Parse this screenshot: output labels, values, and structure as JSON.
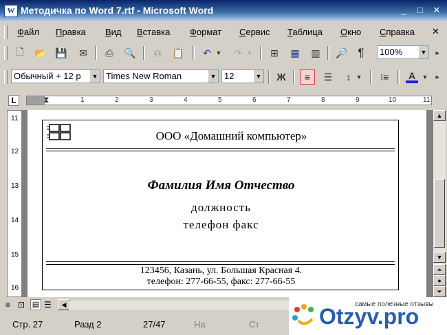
{
  "window": {
    "title": "Методичка по Word 7.rtf - Microsoft Word",
    "app_icon": "W",
    "controls": {
      "minimize": "_",
      "maximize": "□",
      "close": "✕"
    }
  },
  "menu": {
    "items": [
      "Файл",
      "Правка",
      "Вид",
      "Вставка",
      "Формат",
      "Сервис",
      "Таблица",
      "Окно",
      "Справка"
    ],
    "close_doc": "✕"
  },
  "toolbar_standard": {
    "zoom": "100%"
  },
  "toolbar_formatting": {
    "style": "Обычный + 12 p",
    "font": "Times New Roman",
    "size": "12",
    "bold_label": "Ж"
  },
  "ruler": {
    "tab_selector": "L",
    "marks": [
      "1",
      "2",
      "3",
      "4",
      "5",
      "6",
      "7",
      "8",
      "9",
      "10",
      "11"
    ],
    "vertical_marks": [
      "11",
      "12",
      "13",
      "14",
      "15",
      "16"
    ]
  },
  "document": {
    "company": "ООО «Домашний компьютер»",
    "name": "Фамилия Имя Отчество",
    "position": "должность",
    "phones": "телефон факс",
    "address": "123456, Казань, ул. Большая Красная 4.",
    "contacts": "телефон: 277-66-55, факс: 277-66-55"
  },
  "statusbar": {
    "page": "Стр. 27",
    "section": "Разд  2",
    "pages": "27/47",
    "at": "На",
    "line": "Ст"
  },
  "watermark": {
    "tagline": "самые полезные отзывы",
    "brand": "Otzyv.pro"
  },
  "colors": {
    "title_start": "#0a246a",
    "title_end": "#a6caf0",
    "font_color_underline": "#1f1fcf",
    "brand": "#2a5db0"
  }
}
